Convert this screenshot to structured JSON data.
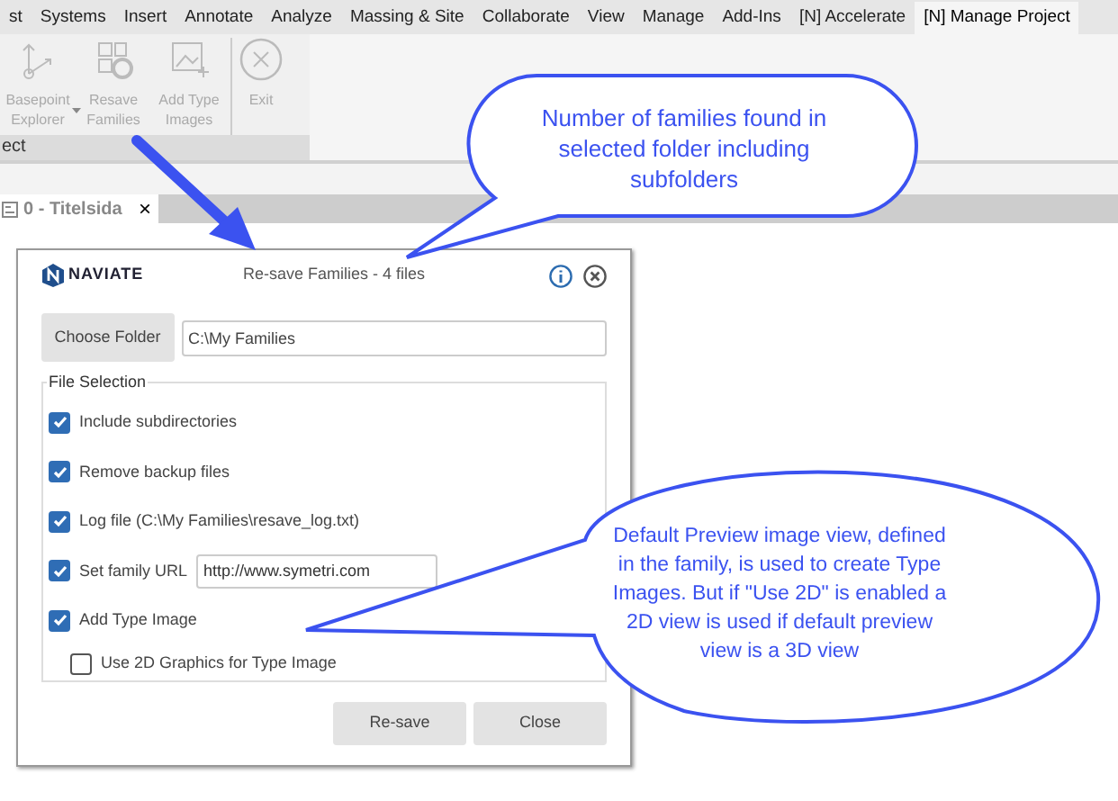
{
  "ribbon_tabs": [
    {
      "label": "st",
      "selected": false
    },
    {
      "label": "Systems",
      "selected": false
    },
    {
      "label": "Insert",
      "selected": false
    },
    {
      "label": "Annotate",
      "selected": false
    },
    {
      "label": "Analyze",
      "selected": false
    },
    {
      "label": "Massing & Site",
      "selected": false
    },
    {
      "label": "Collaborate",
      "selected": false
    },
    {
      "label": "View",
      "selected": false
    },
    {
      "label": "Manage",
      "selected": false
    },
    {
      "label": "Add-Ins",
      "selected": false
    },
    {
      "label": "[N] Accelerate",
      "selected": false
    },
    {
      "label": "[N] Manage Project",
      "selected": true
    }
  ],
  "ribbon_tools": [
    {
      "kind": "basepoint",
      "label": "Basepoint Explorer",
      "dropdown": true,
      "disabled": true
    },
    {
      "kind": "resave",
      "label": "Resave Families",
      "dropdown": false,
      "disabled": true
    },
    {
      "kind": "image",
      "label": "Add Type Images",
      "dropdown": false,
      "disabled": true
    },
    {
      "kind": "exit",
      "label": "Exit",
      "dropdown": false,
      "disabled": true
    }
  ],
  "ribbon_panel_label": "ect",
  "view_tab": {
    "title": "0 - Titelsida",
    "close": "×"
  },
  "dialog": {
    "logo": "NAVIATE",
    "title": "Re-save Families - 4 files",
    "choose_folder": "Choose Folder",
    "folder_path": "C:\\My Families",
    "group_title": "File Selection",
    "options": [
      {
        "kind": "check",
        "label": "Include subdirectories",
        "checked": true
      },
      {
        "kind": "check",
        "label": "Remove backup files",
        "checked": true
      },
      {
        "kind": "check",
        "label": "Log file (C:\\My Families\\resave_log.txt)",
        "checked": true
      },
      {
        "kind": "url",
        "label": "Set family URL",
        "checked": true,
        "value": "http://www.symetri.com"
      },
      {
        "kind": "check",
        "label": "Add Type Image",
        "checked": true
      },
      {
        "kind": "sub",
        "label": "Use 2D Graphics for Type Image",
        "checked": false
      }
    ],
    "buttons": [
      "Re-save",
      "Close"
    ]
  },
  "callouts": [
    {
      "text": "Number of families found in selected folder including subfolders"
    },
    {
      "text": "Default Preview image view, defined in the family, is used to create Type Images. But if \"Use 2D\" is enabled a 2D view is used if default preview view is a 3D view"
    }
  ]
}
